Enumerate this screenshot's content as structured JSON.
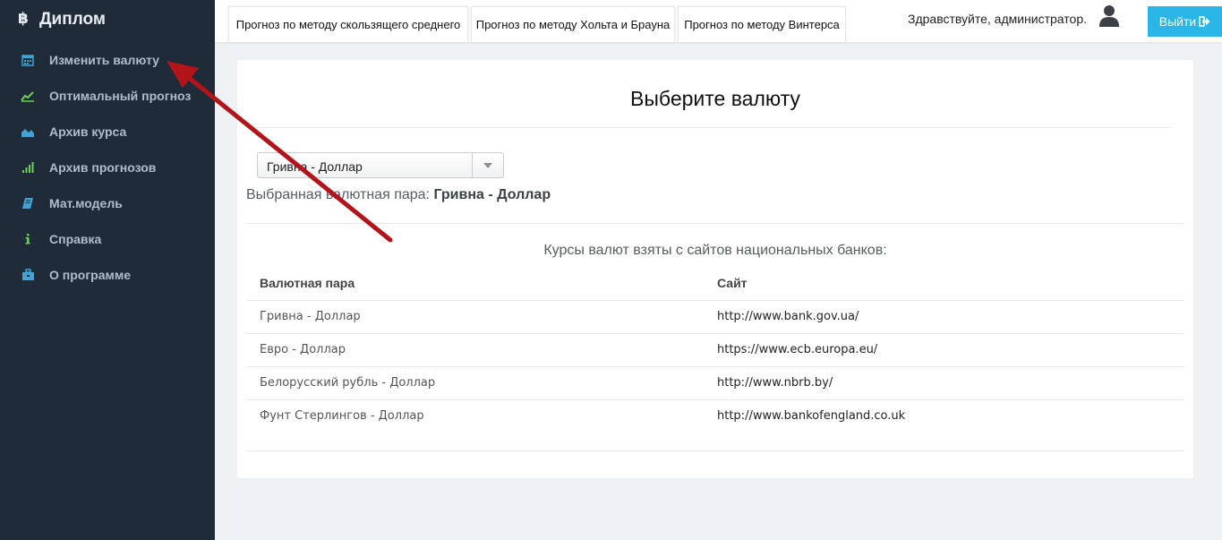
{
  "sidebar": {
    "brand": "Диплом",
    "items": [
      {
        "label": "Изменить валюту",
        "icon": "calendar-icon",
        "color": "#3fa3d6"
      },
      {
        "label": "Оптимальный прогноз",
        "icon": "line-chart-icon",
        "color": "#6ccf5a"
      },
      {
        "label": "Архив курса",
        "icon": "area-chart-icon",
        "color": "#3fa3d6"
      },
      {
        "label": "Архив прогнозов",
        "icon": "signal-icon",
        "color": "#6ccf5a"
      },
      {
        "label": "Мат.модель",
        "icon": "book-icon",
        "color": "#3fa3d6"
      },
      {
        "label": "Справка",
        "icon": "info-icon",
        "color": "#6ccf5a"
      },
      {
        "label": "О программе",
        "icon": "briefcase-icon",
        "color": "#3fa3d6"
      }
    ]
  },
  "topbar": {
    "tabs": [
      "Прогноз по методу скользящего среднего",
      "Прогноз по методу Хольта и Брауна",
      "Прогноз по методу Винтерса"
    ],
    "greeting": "Здравствуйте, администратор.",
    "logout_label": "Выйти"
  },
  "main": {
    "title": "Выберите валюту",
    "select_value": "Гривна - Доллар",
    "selected_prefix": "Выбранная валютная пара: ",
    "selected_value": "Гривна - Доллар",
    "rates_caption": "Курсы валют взяты с сайтов национальных банков:",
    "table": {
      "headers": [
        "Валютная пара",
        "Сайт"
      ],
      "rows": [
        [
          "Гривна - Доллар",
          "http://www.bank.gov.ua/"
        ],
        [
          "Евро - Доллар",
          "https://www.ecb.europa.eu/"
        ],
        [
          "Белорусский рубль - Доллар",
          "http://www.nbrb.by/"
        ],
        [
          "Фунт Стерлингов - Доллар",
          "http://www.bankofengland.co.uk"
        ]
      ]
    }
  },
  "colors": {
    "sidebar_bg": "#1f2b38",
    "accent": "#29b6e6",
    "annotation_arrow": "#c0141a"
  }
}
